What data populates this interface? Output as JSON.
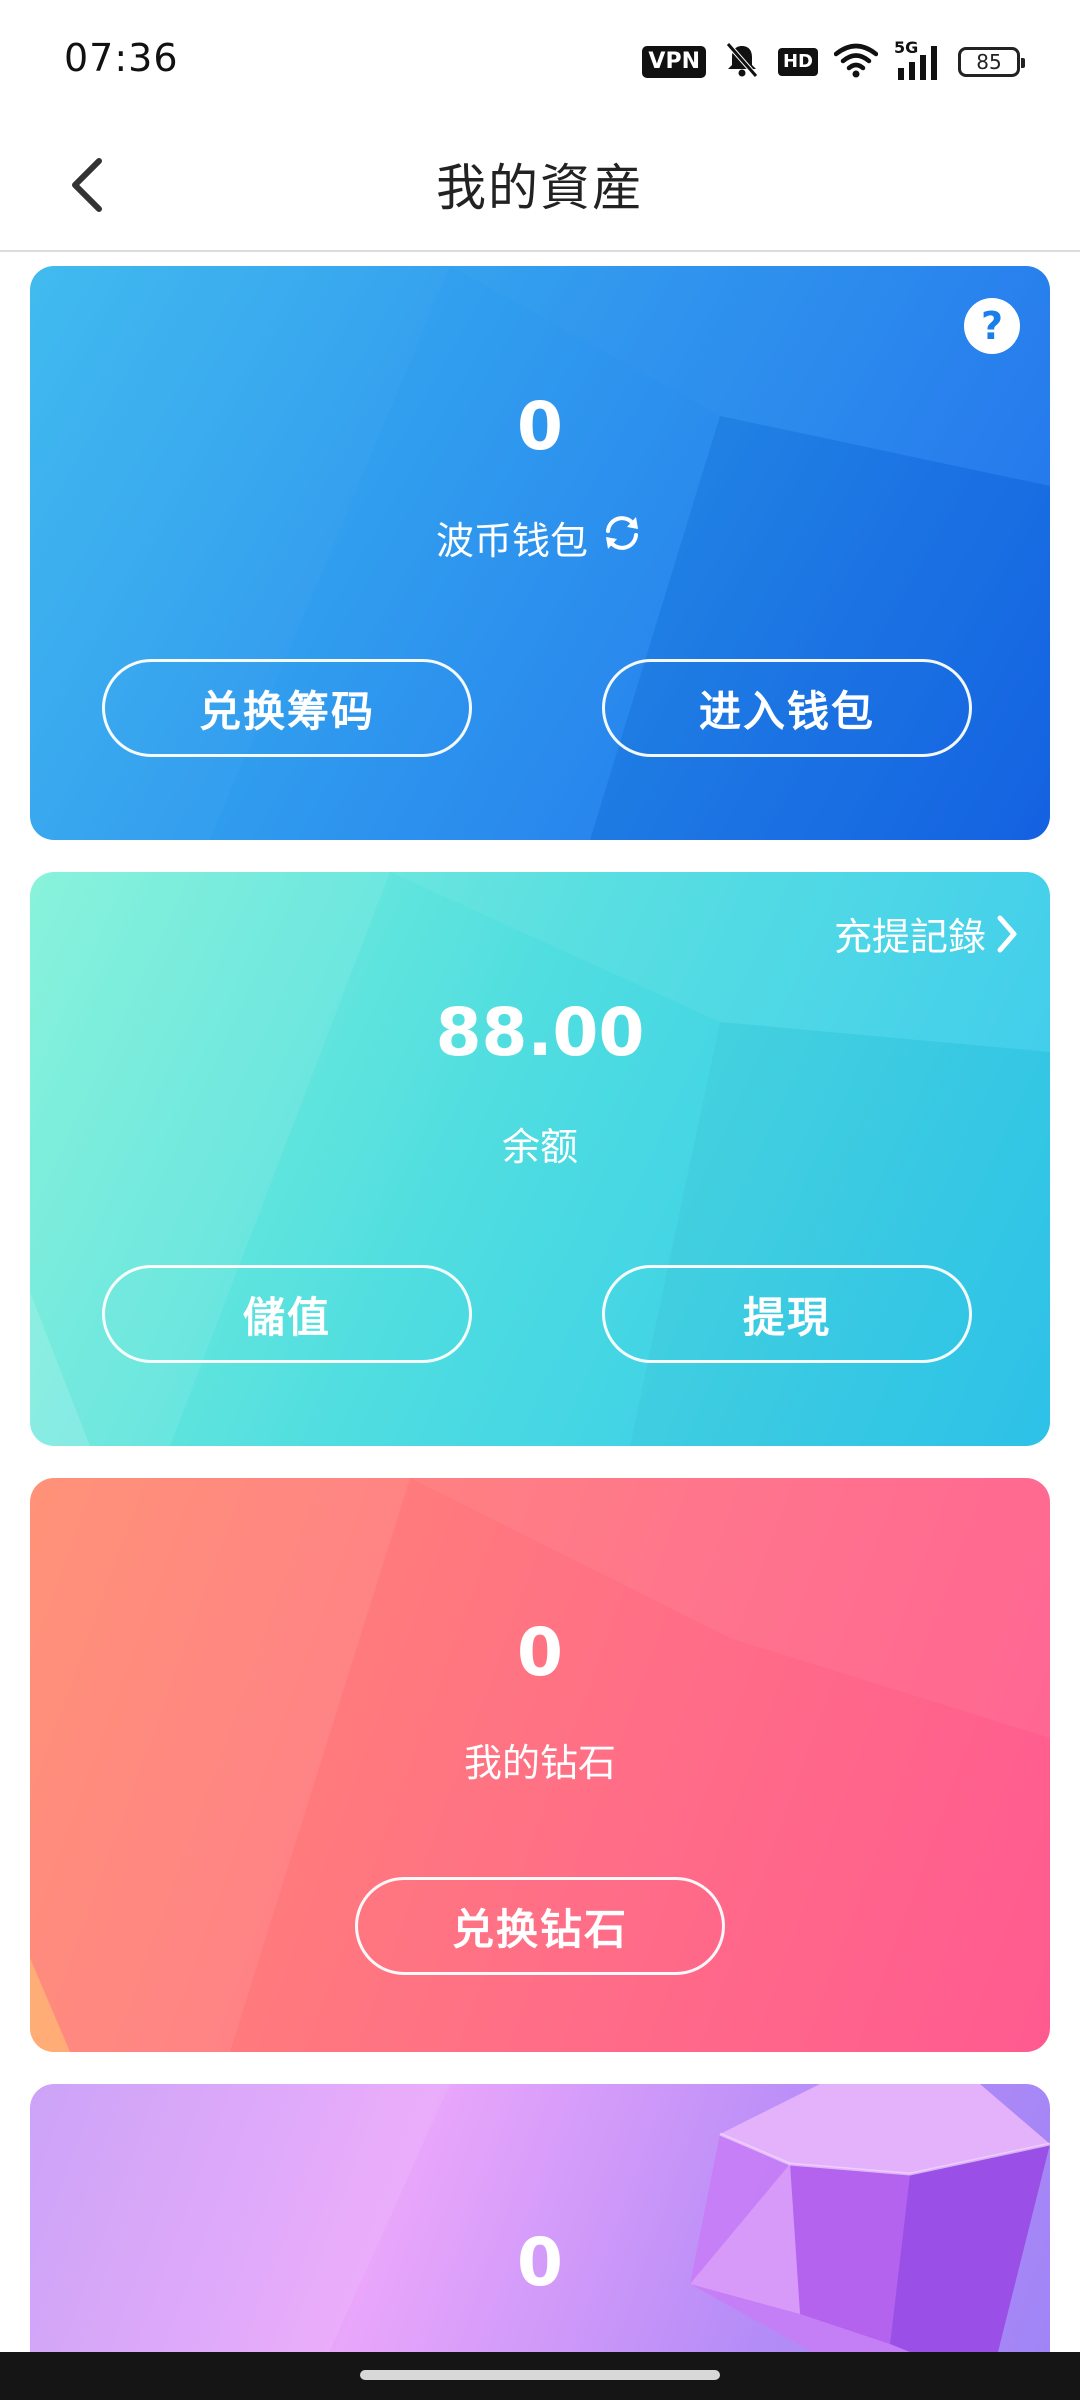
{
  "status_bar": {
    "time": "07:36",
    "vpn": "VPN",
    "hd": "HD",
    "network": "5G",
    "battery": "85",
    "icons": [
      "mute-icon",
      "wifi-icon",
      "signal-icon",
      "battery-icon"
    ]
  },
  "nav": {
    "title": "我的資産",
    "back_icon": "chevron-left-icon"
  },
  "cards": {
    "wallet": {
      "value": "0",
      "label": "波币钱包",
      "refresh_icon": "refresh-icon",
      "help_icon": "question-icon",
      "help_glyph": "?",
      "buttons": {
        "exchange": "兑换筹码",
        "enter": "进入钱包"
      },
      "color": "#2692ee"
    },
    "balance": {
      "records_link": "充提記錄",
      "value": "88.00",
      "label": "余额",
      "buttons": {
        "deposit": "儲值",
        "withdraw": "提現"
      },
      "color": "#4fdde0"
    },
    "diamonds": {
      "value": "0",
      "label": "我的钻石",
      "buttons": {
        "exchange": "兑换钻石"
      },
      "color": "#ff6f86"
    },
    "gems": {
      "value": "0",
      "image": "gem-illustration",
      "color": "#b58cf7"
    }
  }
}
